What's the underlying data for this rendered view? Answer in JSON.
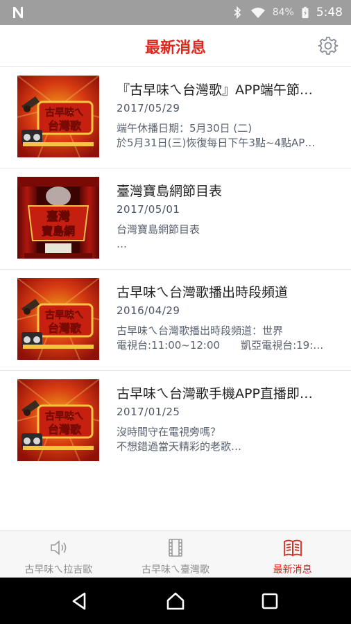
{
  "status_bar": {
    "battery_percent": "84%",
    "time": "5:48"
  },
  "header": {
    "title": "最新消息",
    "settings_icon": "gear-icon"
  },
  "news": [
    {
      "title": "『古早味ㄟ台灣歌』APP端午節…",
      "date": "2017/05/29",
      "snippet_line1": "端午休播日期：5月30日 (二)",
      "snippet_line2": "於5月31日(三)恢復每日下午3點~4點AP…",
      "thumb_text_top": "古早味ㄟ",
      "thumb_text_bottom": "台灣歌"
    },
    {
      "title": "臺灣寶島網節目表",
      "date": "2017/05/01",
      "snippet_line1": "台灣寶島網節目表",
      "snippet_line2": "…",
      "thumb_text_top": "臺灣",
      "thumb_text_bottom": "寶島網"
    },
    {
      "title": "古早味ㄟ台灣歌播出時段頻道",
      "date": "2016/04/29",
      "snippet_line1": "古早味ㄟ台灣歌播出時段頻道：世界",
      "snippet_line2": "電視台:11:00~12:00　　凱亞電視台:19:…",
      "thumb_text_top": "古早味ㄟ",
      "thumb_text_bottom": "台灣歌"
    },
    {
      "title": "古早味ㄟ台灣歌手機APP直播即…",
      "date": "2017/01/25",
      "snippet_line1": "沒時間守在電視旁嗎？",
      "snippet_line2": "不想錯過當天精彩的老歌…",
      "thumb_text_top": "古早味ㄟ",
      "thumb_text_bottom": "台灣歌"
    }
  ],
  "tabs": [
    {
      "label": "古早味ㄟ拉吉歐",
      "icon": "speaker-icon",
      "active": false
    },
    {
      "label": "古早味ㄟ臺灣歌",
      "icon": "film-icon",
      "active": false
    },
    {
      "label": "最新消息",
      "icon": "book-icon",
      "active": true
    }
  ],
  "colors": {
    "accent": "#e0271d",
    "thumb_bg": "#b8160f"
  }
}
